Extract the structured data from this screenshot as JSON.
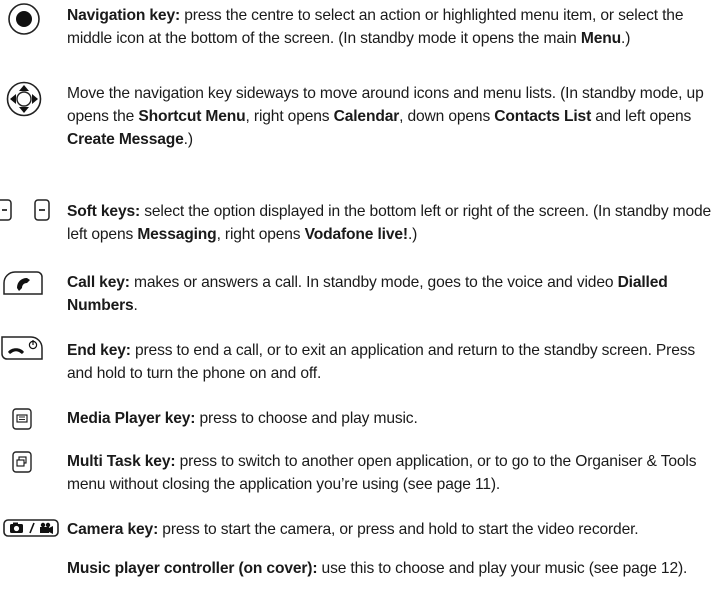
{
  "entries": [
    {
      "icon": "navigation-key-select-icon",
      "segments": [
        {
          "text": "Navigation key:",
          "bold": true
        },
        {
          "text": " press the centre to select an action or highlighted menu item, or select the middle icon at the bottom of the screen. (In standby mode it opens the main ",
          "bold": false
        },
        {
          "text": "Menu",
          "bold": true
        },
        {
          "text": ".)",
          "bold": false
        }
      ]
    },
    {
      "icon": "navigation-key-directions-icon",
      "segments": [
        {
          "text": "Move the navigation key sideways to move around icons and menu lists. (In standby mode, up opens the ",
          "bold": false
        },
        {
          "text": "Shortcut Menu",
          "bold": true
        },
        {
          "text": ", right opens ",
          "bold": false
        },
        {
          "text": "Calendar",
          "bold": true
        },
        {
          "text": ", down opens ",
          "bold": false
        },
        {
          "text": "Contacts List",
          "bold": true
        },
        {
          "text": " and left opens ",
          "bold": false
        },
        {
          "text": "Create Message",
          "bold": true
        },
        {
          "text": ".)",
          "bold": false
        }
      ]
    },
    {
      "icon": "soft-keys-icon",
      "segments": [
        {
          "text": "Soft keys:",
          "bold": true
        },
        {
          "text": " select the option displayed in the bottom left or right of the screen. (In standby mode left opens ",
          "bold": false
        },
        {
          "text": "Messaging",
          "bold": true
        },
        {
          "text": ", right opens ",
          "bold": false
        },
        {
          "text": "Vodafone live!",
          "bold": true
        },
        {
          "text": ".)",
          "bold": false
        }
      ]
    },
    {
      "icon": "call-key-icon",
      "segments": [
        {
          "text": "Call key:",
          "bold": true
        },
        {
          "text": " makes or answers a call. In standby mode, goes to the voice and video ",
          "bold": false
        },
        {
          "text": "Dialled Numbers",
          "bold": true
        },
        {
          "text": ".",
          "bold": false
        }
      ]
    },
    {
      "icon": "end-key-icon",
      "segments": [
        {
          "text": "End key:",
          "bold": true
        },
        {
          "text": " press to end a call, or to exit an application and return to the standby screen. Press and hold to turn the phone on and off.",
          "bold": false
        }
      ]
    },
    {
      "icon": "media-player-key-icon",
      "segments": [
        {
          "text": "Media Player key:",
          "bold": true
        },
        {
          "text": " press to choose and play music.",
          "bold": false
        }
      ]
    },
    {
      "icon": "multi-task-key-icon",
      "segments": [
        {
          "text": "Multi Task key:",
          "bold": true
        },
        {
          "text": " press to switch to another open application, or to go to the Organiser & Tools menu without closing the application you’re using (see page 11).",
          "bold": false
        }
      ]
    },
    {
      "icon": "camera-key-icon",
      "segments": [
        {
          "text": "Camera key:",
          "bold": true
        },
        {
          "text": " press to start the camera, or press and hold to start the video recorder.",
          "bold": false
        }
      ]
    },
    {
      "icon": "",
      "segments": [
        {
          "text": "Music player controller (on cover):",
          "bold": true
        },
        {
          "text": " use this to choose and play your music (see page 12).",
          "bold": false
        }
      ]
    }
  ]
}
